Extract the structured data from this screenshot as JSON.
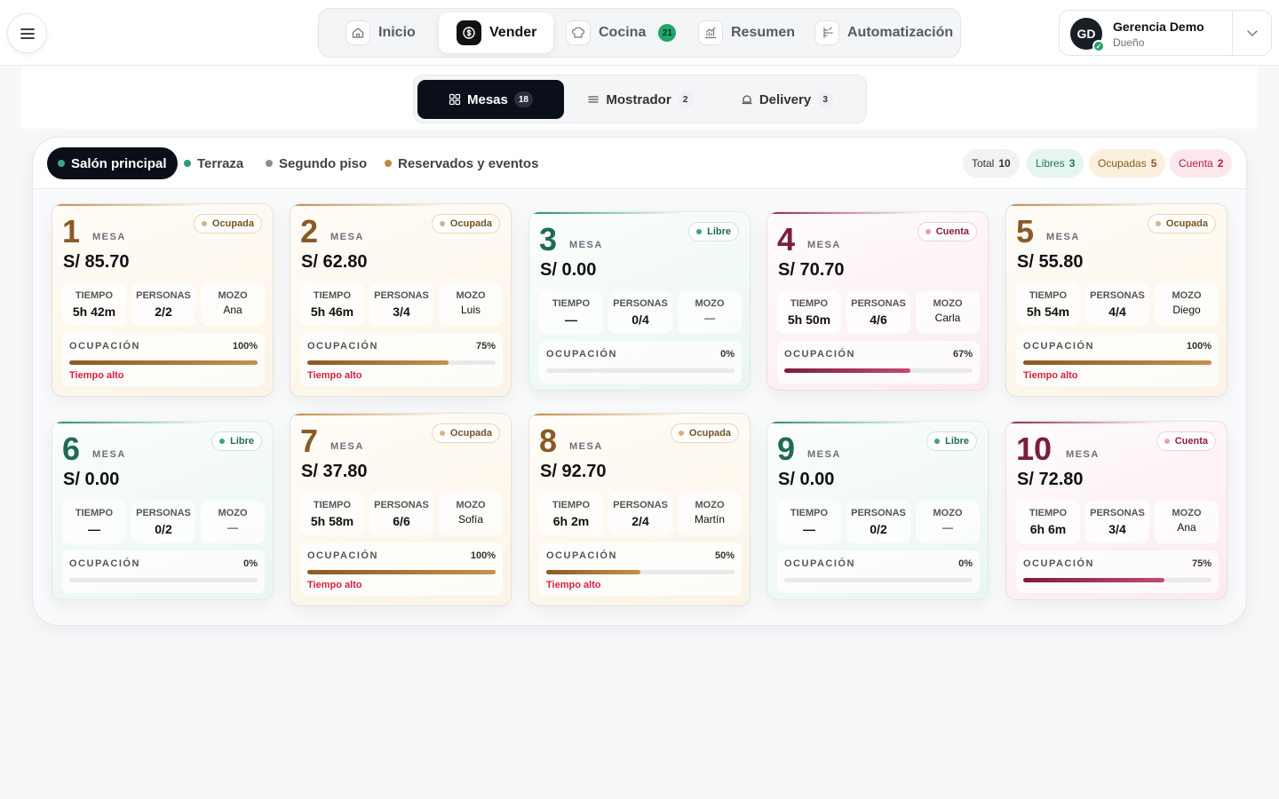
{
  "topnav": {
    "items": [
      {
        "label": "Inicio",
        "icon": "home-icon"
      },
      {
        "label": "Vender",
        "icon": "dollar-icon",
        "active": true
      },
      {
        "label": "Cocina",
        "icon": "kitchen-icon",
        "badge": "21"
      },
      {
        "label": "Resumen",
        "icon": "chart-icon"
      },
      {
        "label": "Automatización",
        "icon": "automation-icon"
      }
    ]
  },
  "user": {
    "initials": "GD",
    "name": "Gerencia Demo",
    "role": "Dueño"
  },
  "modes": [
    {
      "label": "Mesas",
      "count": "18",
      "active": true
    },
    {
      "label": "Mostrador",
      "count": "2"
    },
    {
      "label": "Delivery",
      "count": "3"
    }
  ],
  "zones": [
    {
      "label": "Salón principal",
      "dot": "#3fa58a",
      "active": true
    },
    {
      "label": "Terraza",
      "dot": "#2e9b72"
    },
    {
      "label": "Segundo piso",
      "dot": "#8a8f99"
    },
    {
      "label": "Reservados y eventos",
      "dot": "#c0883f"
    }
  ],
  "stats": [
    {
      "label": "Total",
      "value": "10"
    },
    {
      "label": "Libres",
      "value": "3"
    },
    {
      "label": "Ocupadas",
      "value": "5"
    },
    {
      "label": "Cuenta",
      "value": "2"
    }
  ],
  "labels": {
    "mesa": "MESA",
    "tiempo": "TIEMPO",
    "personas": "PERSONAS",
    "mozo": "MOZO",
    "ocupacion": "OCUPACIÓN",
    "tiempo_alto": "Tiempo alto"
  },
  "colors": {
    "ocupada": "#8a5a25",
    "libre": "#1f6b52",
    "cuenta": "#7a1f3a",
    "alert": "#d51f3f"
  },
  "tables": [
    {
      "num": "1",
      "status": "Ocupada",
      "price": "S/ 85.70",
      "tiempo": "5h 42m",
      "personas": "2/2",
      "mozo": "Ana",
      "occ": "100%",
      "occ_value": 1.0,
      "alert": true
    },
    {
      "num": "2",
      "status": "Ocupada",
      "price": "S/ 62.80",
      "tiempo": "5h 46m",
      "personas": "3/4",
      "mozo": "Luis",
      "occ": "75%",
      "occ_value": 0.75,
      "alert": true
    },
    {
      "num": "3",
      "status": "Libre",
      "price": "S/ 0.00",
      "tiempo": "—",
      "personas": "0/4",
      "mozo": "—",
      "occ": "0%",
      "occ_value": 0,
      "alert": false
    },
    {
      "num": "4",
      "status": "Cuenta",
      "price": "S/ 70.70",
      "tiempo": "5h 50m",
      "personas": "4/6",
      "mozo": "Carla",
      "occ": "67%",
      "occ_value": 0.67,
      "alert": false
    },
    {
      "num": "5",
      "status": "Ocupada",
      "price": "S/ 55.80",
      "tiempo": "5h 54m",
      "personas": "4/4",
      "mozo": "Diego",
      "occ": "100%",
      "occ_value": 1.0,
      "alert": true
    },
    {
      "num": "6",
      "status": "Libre",
      "price": "S/ 0.00",
      "tiempo": "—",
      "personas": "0/2",
      "mozo": "—",
      "occ": "0%",
      "occ_value": 0,
      "alert": false
    },
    {
      "num": "7",
      "status": "Ocupada",
      "price": "S/ 37.80",
      "tiempo": "5h 58m",
      "personas": "6/6",
      "mozo": "Sofía",
      "occ": "100%",
      "occ_value": 1.0,
      "alert": true
    },
    {
      "num": "8",
      "status": "Ocupada",
      "price": "S/ 92.70",
      "tiempo": "6h 2m",
      "personas": "2/4",
      "mozo": "Martín",
      "occ": "50%",
      "occ_value": 0.5,
      "alert": true
    },
    {
      "num": "9",
      "status": "Libre",
      "price": "S/ 0.00",
      "tiempo": "—",
      "personas": "0/2",
      "mozo": "—",
      "occ": "0%",
      "occ_value": 0,
      "alert": false
    },
    {
      "num": "10",
      "status": "Cuenta",
      "price": "S/ 72.80",
      "tiempo": "6h 6m",
      "personas": "3/4",
      "mozo": "Ana",
      "occ": "75%",
      "occ_value": 0.75,
      "alert": false
    }
  ]
}
